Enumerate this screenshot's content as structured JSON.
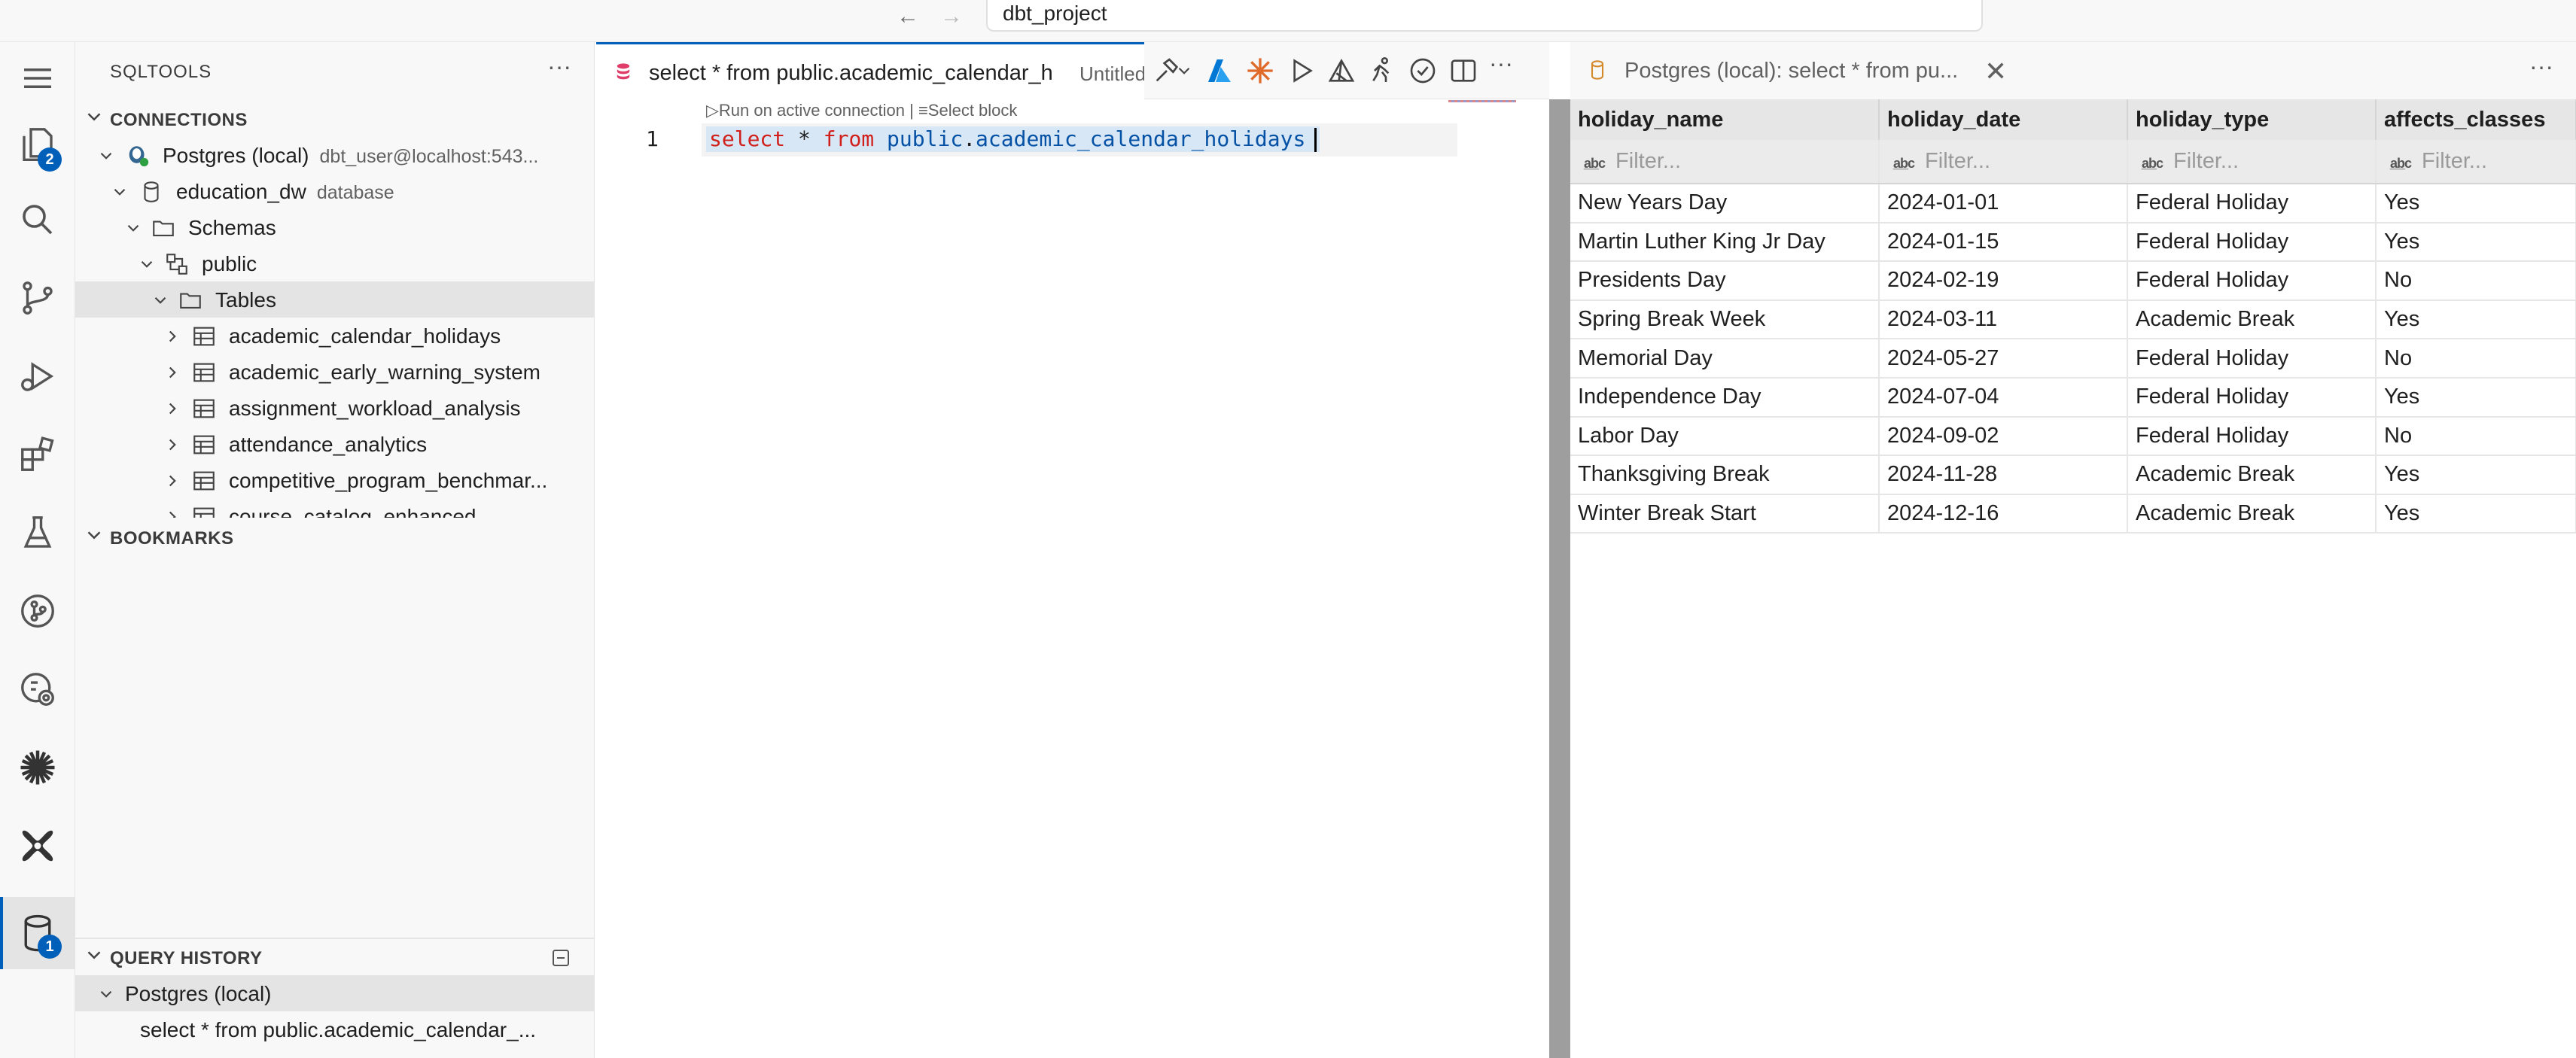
{
  "titlebar": {
    "search_text": "dbt_project"
  },
  "activity_bar": {
    "icons": [
      "menu-icon",
      "explorer-icon",
      "search-icon",
      "source-control-icon",
      "run-debug-icon",
      "extensions-icon",
      "testing-icon",
      "git-graph-icon",
      "remote-explorer-icon",
      "asterisk-icon",
      "dbt-icon",
      "database-icon"
    ],
    "explorer_badge": "2",
    "database_badge": "1"
  },
  "sidebar": {
    "title": "SQLTOOLS",
    "connections": {
      "header": "CONNECTIONS",
      "connection_name": "Postgres (local)",
      "connection_desc": "dbt_user@localhost:543...",
      "database_name": "education_dw",
      "database_desc": "database",
      "schemas_label": "Schemas",
      "schema_name": "public",
      "tables_label": "Tables",
      "tables": [
        "academic_calendar_holidays",
        "academic_early_warning_system",
        "assignment_workload_analysis",
        "attendance_analytics",
        "competitive_program_benchmar...",
        "course_catalog_enhanced"
      ]
    },
    "bookmarks": {
      "header": "BOOKMARKS"
    },
    "query_history": {
      "header": "QUERY HISTORY",
      "connection": "Postgres (local)",
      "query": "select * from public.academic_calendar_..."
    }
  },
  "editor": {
    "tab_title": "select * from public.academic_calendar_h",
    "tab_desc": "Untitled",
    "codelens_run": "Run on active connection",
    "codelens_sep": "|",
    "codelens_select": "Select block",
    "line_number": "1",
    "code": {
      "kw_select": "select",
      "star": "*",
      "kw_from": "from",
      "schema": "public",
      "dot": ".",
      "table": "academic_calendar_holidays"
    }
  },
  "results": {
    "tab_title": "Postgres (local): select * from pu...",
    "filter_placeholder": "Filter...",
    "columns": [
      "holiday_name",
      "holiday_date",
      "holiday_type",
      "affects_classes"
    ],
    "rows": [
      [
        "New Years Day",
        "2024-01-01",
        "Federal Holiday",
        "Yes"
      ],
      [
        "Martin Luther King Jr Day",
        "2024-01-15",
        "Federal Holiday",
        "Yes"
      ],
      [
        "Presidents Day",
        "2024-02-19",
        "Federal Holiday",
        "No"
      ],
      [
        "Spring Break Week",
        "2024-03-11",
        "Academic Break",
        "Yes"
      ],
      [
        "Memorial Day",
        "2024-05-27",
        "Federal Holiday",
        "No"
      ],
      [
        "Independence Day",
        "2024-07-04",
        "Federal Holiday",
        "Yes"
      ],
      [
        "Labor Day",
        "2024-09-02",
        "Federal Holiday",
        "No"
      ],
      [
        "Thanksgiving Break",
        "2024-11-28",
        "Academic Break",
        "Yes"
      ],
      [
        "Winter Break Start",
        "2024-12-16",
        "Academic Break",
        "Yes"
      ]
    ]
  },
  "colors": {
    "accent": "#005fb8",
    "keyword": "#d1201b",
    "identifier": "#0451a5"
  }
}
